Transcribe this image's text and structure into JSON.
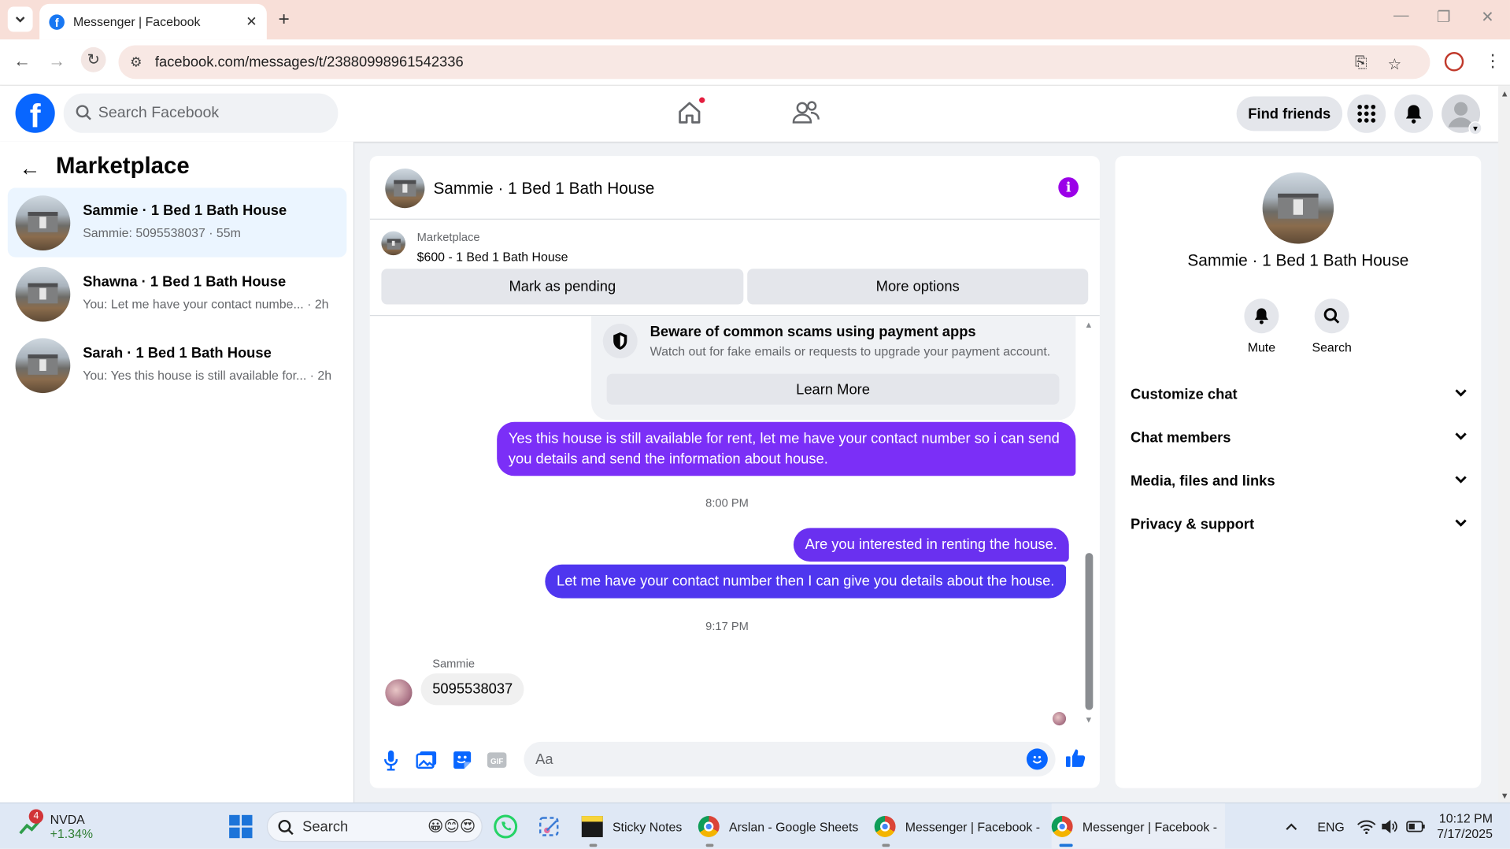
{
  "browser": {
    "tab_title": "Messenger | Facebook",
    "url": "facebook.com/messages/t/23880998961542336"
  },
  "fb_header": {
    "search_placeholder": "Search Facebook",
    "find_friends": "Find friends"
  },
  "sidebar": {
    "title": "Marketplace",
    "conversations": [
      {
        "name": "Sammie · 1 Bed 1 Bath House",
        "preview": "Sammie: 5095538037 · 55m",
        "active": true
      },
      {
        "name": "Shawna · 1 Bed 1 Bath House",
        "preview": "You: Let me have your contact numbe... · 2h",
        "active": false
      },
      {
        "name": "Sarah · 1 Bed 1 Bath House",
        "preview": "You: Yes this house is still available for... · 2h",
        "active": false
      }
    ]
  },
  "chat": {
    "title": "Sammie · 1 Bed 1 Bath House",
    "marketplace_label": "Marketplace",
    "listing": "$600 - 1 Bed 1 Bath House",
    "mark_pending": "Mark as pending",
    "more_options": "More options",
    "scam_notice": {
      "title": "Beware of common scams using payment apps",
      "subtitle": "Watch out for fake emails or requests to upgrade your payment account.",
      "button": "Learn More"
    },
    "messages": [
      {
        "from": "me",
        "text": "Yes this house is still available for rent, let me have your contact number so i can send you details and send the information about house."
      },
      {
        "time": "8:00 PM"
      },
      {
        "from": "me",
        "text": "Are you interested in renting the house."
      },
      {
        "from": "me",
        "text": "Let me have your contact number then I can give you details about the house."
      },
      {
        "time": "9:17 PM"
      },
      {
        "from": "Sammie",
        "text": "5095538037"
      }
    ],
    "sender_name": "Sammie",
    "composer_placeholder": "Aa",
    "bubble_color": "#7b2ff7"
  },
  "right_panel": {
    "name": "Sammie · 1 Bed 1 Bath House",
    "actions": [
      "Mute",
      "Search"
    ],
    "sections": [
      "Customize chat",
      "Chat members",
      "Media, files and links",
      "Privacy & support"
    ]
  },
  "taskbar": {
    "stock_name": "NVDA",
    "stock_change": "+1.34%",
    "stock_badge": "4",
    "search": "Search",
    "apps": [
      "Sticky Notes",
      "Arslan - Google Sheets",
      "Messenger | Facebook -",
      "Messenger | Facebook -"
    ],
    "lang": "ENG",
    "time": "10:12 PM",
    "date": "7/17/2025"
  }
}
